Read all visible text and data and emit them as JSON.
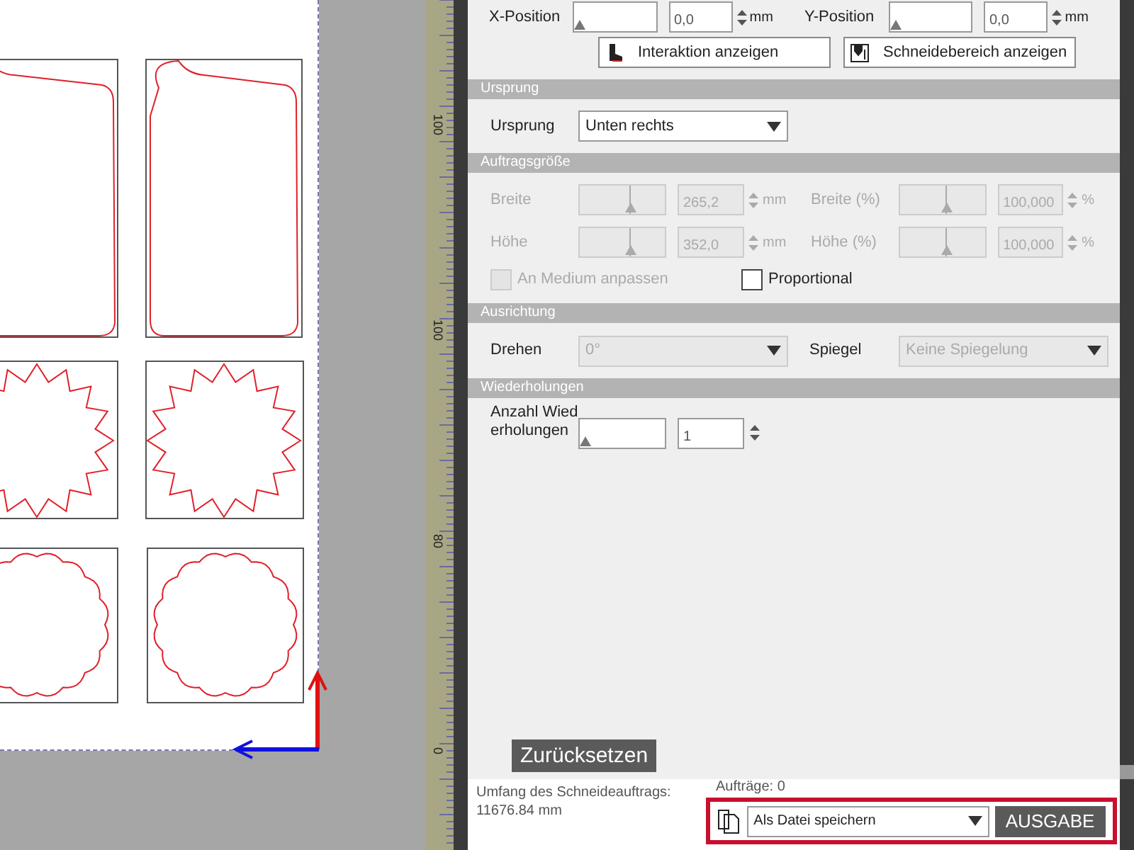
{
  "ruler": {
    "labels": [
      "100",
      "100",
      "80",
      "0"
    ]
  },
  "position": {
    "fields": [
      {
        "label": "X-Position",
        "value": "0,0",
        "unit": "mm",
        "level": 0
      },
      {
        "label": "Y-Position",
        "value": "0,0",
        "unit": "mm",
        "level": 0
      }
    ],
    "buttons": [
      {
        "kind": "interaction",
        "label": "Interaktion anzeigen"
      },
      {
        "kind": "area",
        "label": "Schneidebereich anzeigen"
      }
    ]
  },
  "origin": {
    "header": "Ursprung",
    "label": "Ursprung",
    "value": "Unten rechts"
  },
  "size": {
    "header": "Auftragsgröße",
    "rows": [
      {
        "label": "Breite",
        "value": "265,2",
        "unit": "mm",
        "level": 0.57,
        "disabled": true
      },
      {
        "label": "Breite (%)",
        "value": "100,000",
        "unit": "%",
        "level": 0.52,
        "disabled": true
      },
      {
        "label": "Höhe",
        "value": "352,0",
        "unit": "mm",
        "level": 0.57,
        "disabled": true
      },
      {
        "label": "Höhe (%)",
        "value": "100,000",
        "unit": "%",
        "level": 0.52,
        "disabled": true
      }
    ],
    "checkboxes": [
      {
        "label": "An Medium anpassen",
        "checked": false,
        "disabled": true
      },
      {
        "label": "Proportional",
        "checked": false,
        "disabled": false
      }
    ]
  },
  "orientation": {
    "header": "Ausrichtung",
    "fields": [
      {
        "label": "Drehen",
        "value": "0°",
        "disabled": true
      },
      {
        "label": "Spiegel",
        "value": "Keine Spiegelung",
        "disabled": true
      }
    ]
  },
  "repeats": {
    "header": "Wiederholungen",
    "label": "Anzahl Wiederholungen",
    "value": "1",
    "level": 0
  },
  "reset_button": "Zurücksetzen",
  "footer": {
    "summary_label": "Umfang des Schneideauftrags:",
    "summary_value": "11676.84 mm",
    "jobs": "Aufträge: 0",
    "output_target": "Als Datei speichern",
    "output_button": "AUSGABE"
  }
}
